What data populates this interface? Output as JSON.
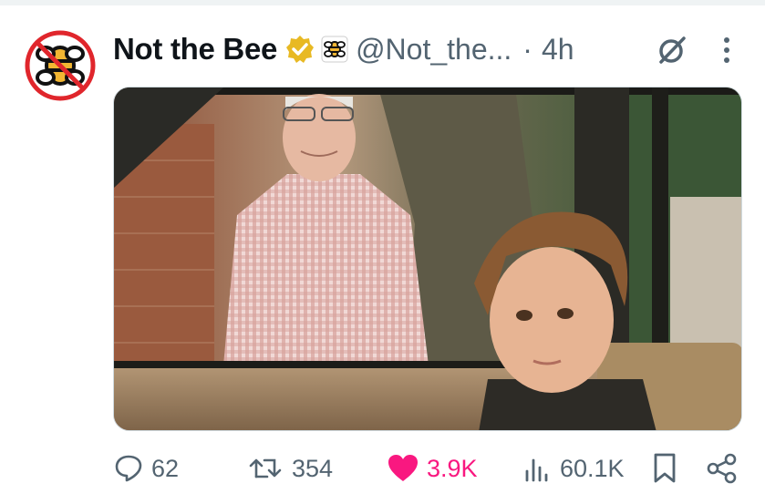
{
  "post": {
    "display_name": "Not the Bee",
    "handle": "@Not_the...",
    "separator": "·",
    "time": "4h",
    "icons": [
      "avatar",
      "verified-badge-icon",
      "affiliate-badge-icon",
      "grok-icon",
      "more-icon"
    ],
    "media": {
      "type": "photo",
      "alt": ""
    }
  },
  "actions": {
    "reply_count": "62",
    "repost_count": "354",
    "like_count": "3.9K",
    "views_count": "60.1K",
    "icons": [
      "reply-icon",
      "repost-icon",
      "like-icon",
      "views-icon",
      "bookmark-icon",
      "share-icon"
    ]
  },
  "colors": {
    "text": "#0f1419",
    "secondary": "#536471",
    "like": "#f91880",
    "verified": "#e8b923",
    "avatar_red": "#e0262c"
  }
}
